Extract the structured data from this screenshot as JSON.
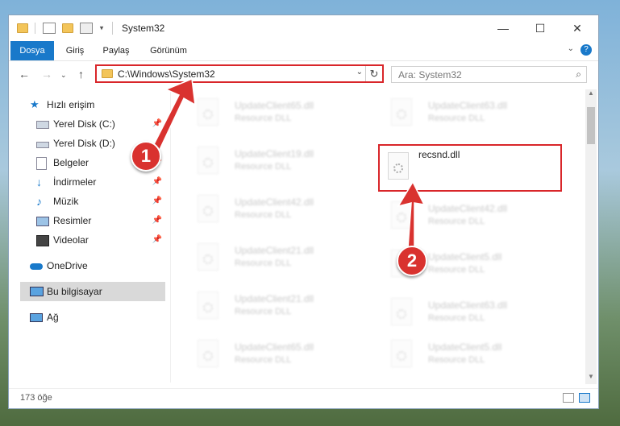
{
  "window": {
    "title": "System32",
    "controls": {
      "minimize": "—",
      "maximize": "☐",
      "close": "✕"
    }
  },
  "ribbon": {
    "tabs": [
      {
        "label": "Dosya"
      },
      {
        "label": "Giriş"
      },
      {
        "label": "Paylaş"
      },
      {
        "label": "Görünüm"
      }
    ],
    "help": "?"
  },
  "nav": {
    "address": "C:\\Windows\\System32",
    "search_placeholder": "Ara: System32"
  },
  "sidebar": {
    "items": [
      {
        "label": "Hızlı erişim",
        "icon": "star-icon",
        "pinned": false
      },
      {
        "label": "Yerel Disk (C:)",
        "icon": "drive-icon",
        "pinned": true
      },
      {
        "label": "Yerel Disk (D:)",
        "icon": "drive-icon",
        "pinned": false
      },
      {
        "label": "Belgeler",
        "icon": "documents-icon",
        "pinned": true
      },
      {
        "label": "İndirmeler",
        "icon": "download-icon",
        "pinned": true
      },
      {
        "label": "Müzik",
        "icon": "music-icon",
        "pinned": true
      },
      {
        "label": "Resimler",
        "icon": "pictures-icon",
        "pinned": true
      },
      {
        "label": "Videolar",
        "icon": "video-icon",
        "pinned": true
      },
      {
        "label": "OneDrive",
        "icon": "cloud-icon",
        "pinned": false
      },
      {
        "label": "Bu bilgisayar",
        "icon": "computer-icon",
        "pinned": false,
        "selected": true
      },
      {
        "label": "Ağ",
        "icon": "network-icon",
        "pinned": false
      }
    ]
  },
  "files": [
    {
      "name": "UpdateClient65.dll",
      "type": "Resource DLL"
    },
    {
      "name": "UpdateClient63.dll",
      "type": "Resource DLL"
    },
    {
      "name": "UpdateClient19.dll",
      "type": "Resource DLL"
    },
    {
      "name": "recsnd.dll",
      "type": ""
    },
    {
      "name": "UpdateClient42.dll",
      "type": "Resource DLL"
    },
    {
      "name": "UpdateClient42.dll",
      "type": "Resource DLL"
    },
    {
      "name": "UpdateClient21.dll",
      "type": "Resource DLL"
    },
    {
      "name": "UpdateClient5.dll",
      "type": "Resource DLL"
    },
    {
      "name": "UpdateClient21.dll",
      "type": "Resource DLL"
    },
    {
      "name": "UpdateClient63.dll",
      "type": "Resource DLL"
    },
    {
      "name": "UpdateClient65.dll",
      "type": "Resource DLL"
    },
    {
      "name": "UpdateClient5.dll",
      "type": "Resource DLL"
    }
  ],
  "status": {
    "count": "173 öğe"
  },
  "annotations": [
    {
      "label": "1"
    },
    {
      "label": "2"
    }
  ],
  "colors": {
    "accent": "#1979ca",
    "highlight": "#d9262a",
    "callout": "#d9322f"
  }
}
